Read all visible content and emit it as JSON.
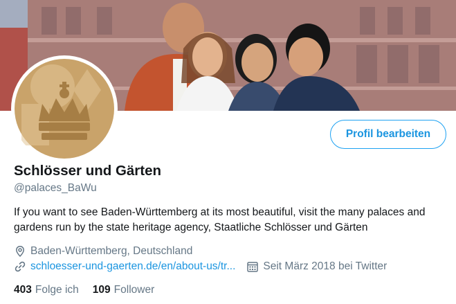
{
  "profile": {
    "edit_button": "Profil bearbeiten",
    "name": "Schlösser und Gärten",
    "handle": "@palaces_BaWu",
    "bio": "If you want to see Baden-Württemberg at its most beautiful, visit the many palaces and gardens run by the state heritage agency, Staatliche Schlösser und Gärten",
    "location": "Baden-Württemberg, Deutschland",
    "website": "schloesser-und-gaerten.de/en/about-us/tr...",
    "joined": "Seit März 2018 bei Twitter",
    "following_count": "403",
    "following_label": "Folge ich",
    "followers_count": "109",
    "followers_label": "Follower"
  },
  "icons": {
    "location": "map-pin-icon",
    "website": "link-icon",
    "joined": "calendar-icon"
  },
  "colors": {
    "accent": "#1da1f2",
    "link": "#1b95e0",
    "muted": "#657786",
    "text": "#14171a",
    "avatar_bg": "#c9a36a"
  }
}
